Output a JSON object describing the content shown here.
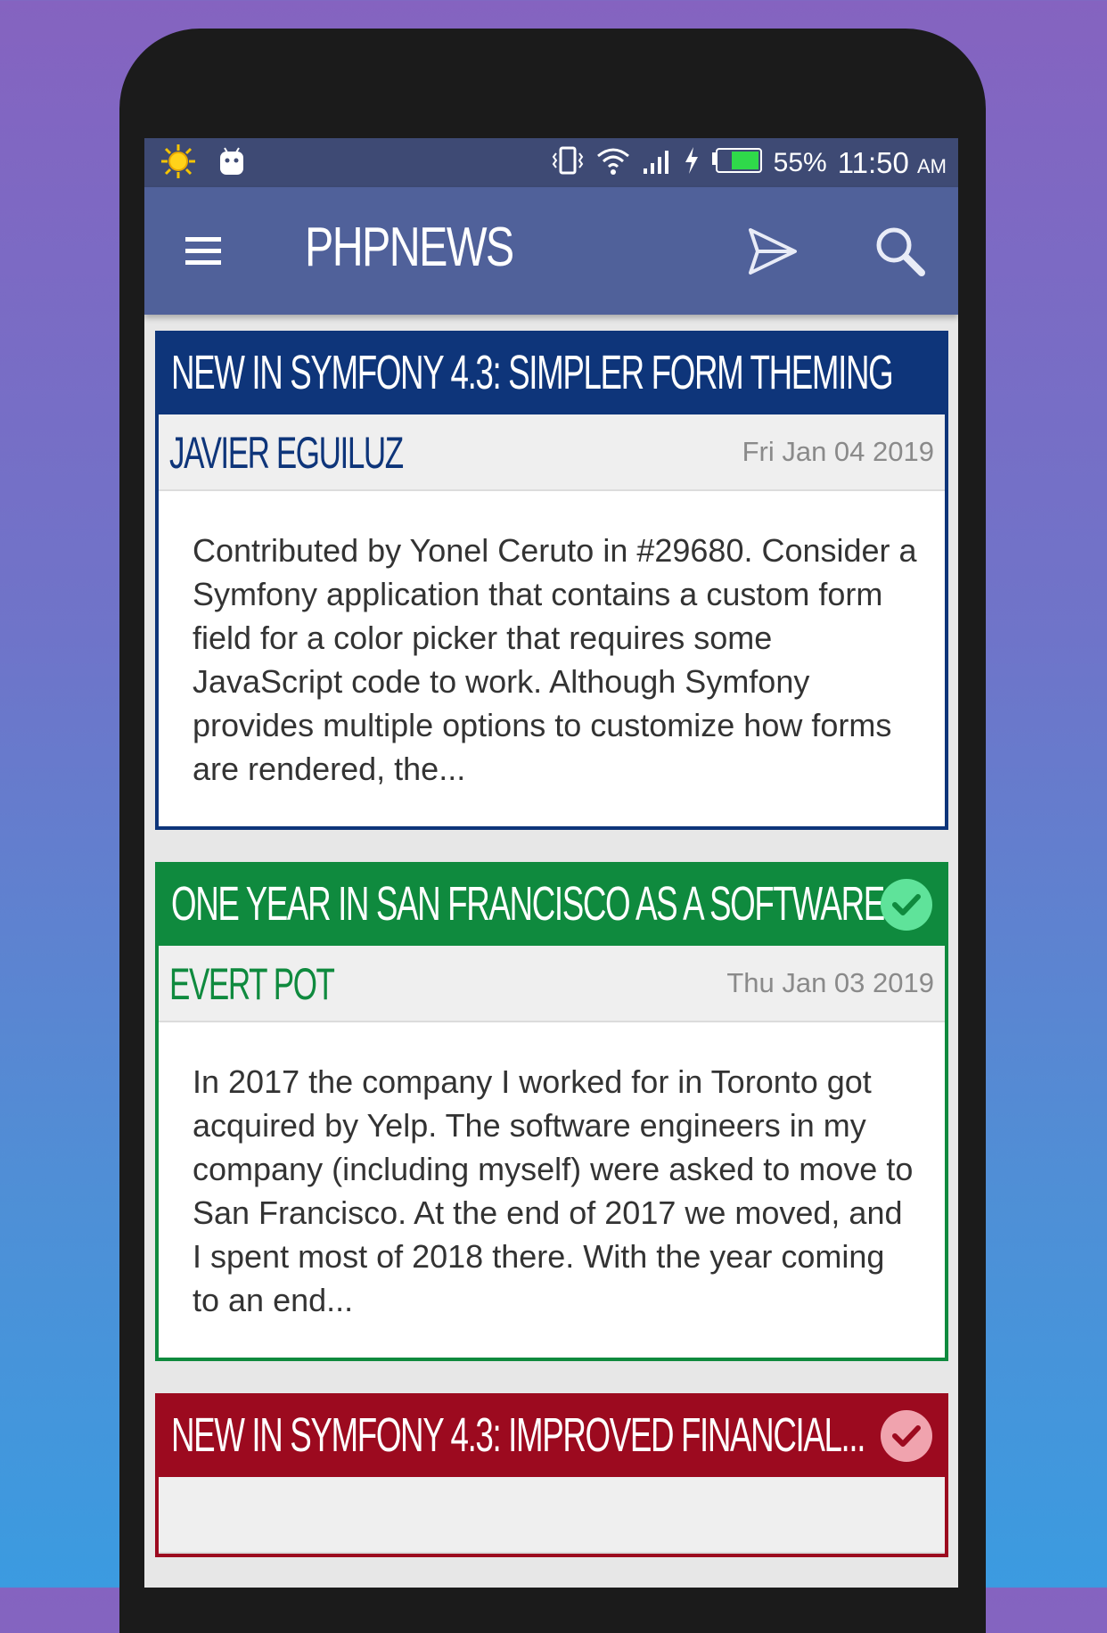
{
  "statusbar": {
    "battery": "55%",
    "time": "11:50",
    "ampm": "AM",
    "icons": [
      "weather-sun-icon",
      "android-icon",
      "vibrate-icon",
      "wifi-icon",
      "signal-icon",
      "charging-icon",
      "battery-icon"
    ]
  },
  "appbar": {
    "title": "PHPNEWS",
    "icons": [
      "menu-icon",
      "send-icon",
      "search-icon"
    ]
  },
  "colors": {
    "blue": "#0e357a",
    "green": "#0f8a3e",
    "red": "#9c0a1f",
    "appbar": "#50619a"
  },
  "articles": [
    {
      "title": "NEW IN SYMFONY 4.3: SIMPLER FORM THEMING",
      "author": "JAVIER EGUILUZ",
      "date": "Fri Jan 04 2019",
      "excerpt": "Contributed by Yonel Ceruto in #29680. Consider a Symfony application that contains a custom form field for a color picker that requires some JavaScript code to work. Although Symfony provides multiple options to customize how forms are rendered, the...",
      "read": false
    },
    {
      "title": "ONE YEAR IN SAN FRANCISCO AS A SOFTWARE...",
      "author": "EVERT POT",
      "date": "Thu Jan 03 2019",
      "excerpt": "In 2017 the company I worked for in Toronto got acquired by Yelp. The software engineers in my company (including myself) were asked to move to San Francisco. At the end of 2017 we moved, and I spent most of 2018 there. With the year coming to an end...",
      "read": true
    },
    {
      "title": "NEW IN SYMFONY 4.3: IMPROVED FINANCIAL...",
      "read": true
    }
  ]
}
